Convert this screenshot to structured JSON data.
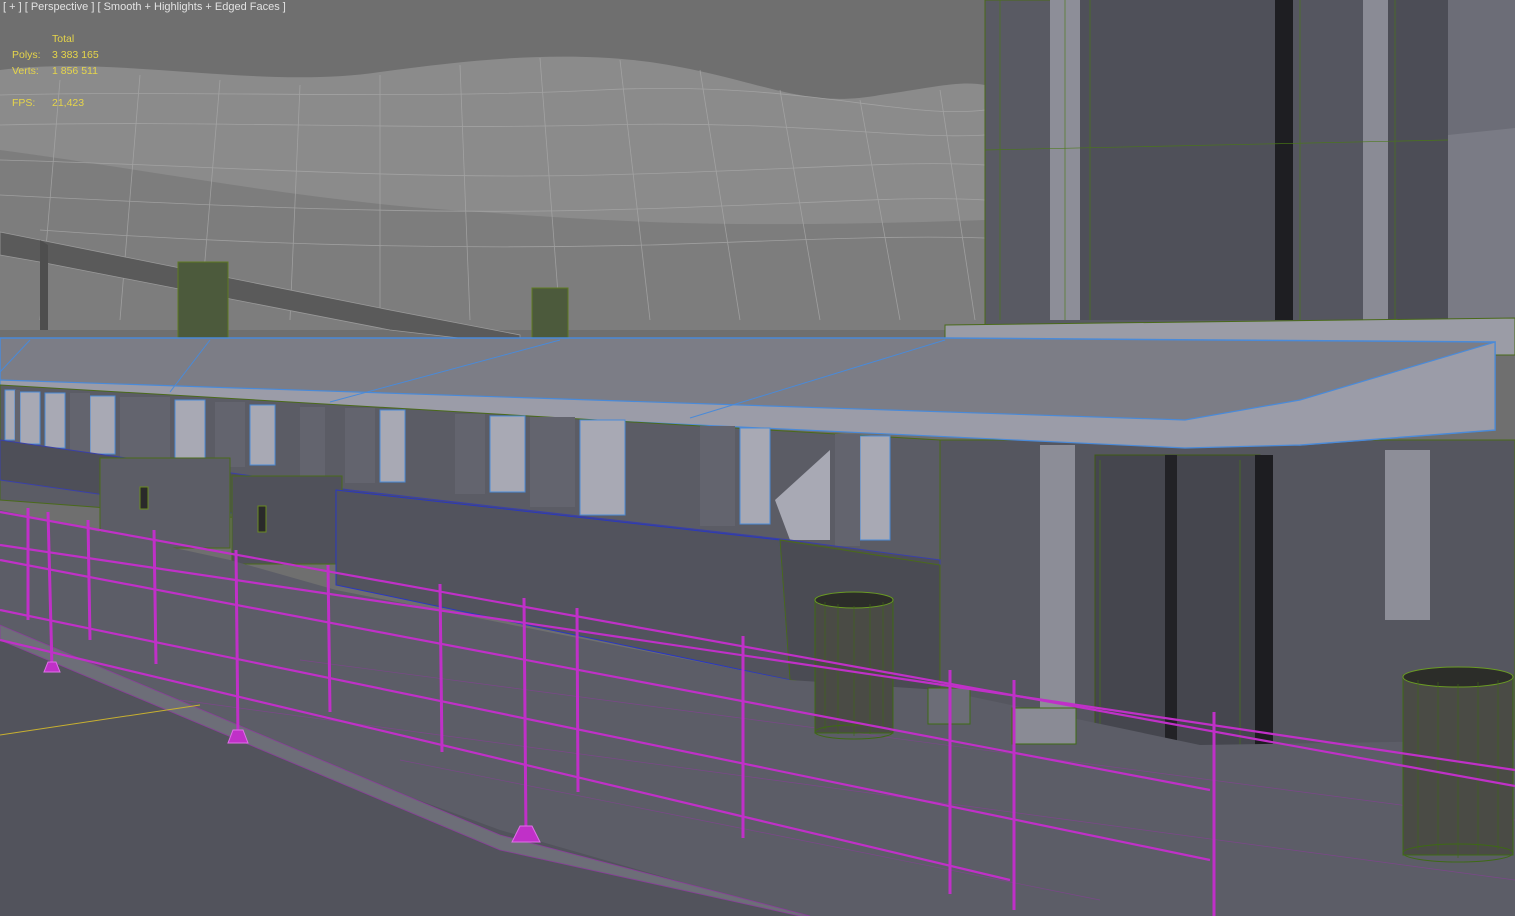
{
  "viewport": {
    "label_plus": "[ + ]",
    "label_view": "[ Perspective ]",
    "label_shading": "[ Smooth + Highlights + Edged Faces ]"
  },
  "stats": {
    "header": "Total",
    "polys_label": "Polys:",
    "polys_value": "3 383 165",
    "verts_label": "Verts:",
    "verts_value": "1 856 511",
    "fps_label": "FPS:",
    "fps_value": "21,423"
  },
  "colors": {
    "background": "#6e6e6e",
    "terrain": "#8a8a8a",
    "building": "#55565e",
    "building_edge": "#4a6a1a",
    "awning_edge": "#4a8ad8",
    "railing": "#c030c8",
    "stats_text": "#e6d54a",
    "label_text": "#e2e2e2"
  }
}
